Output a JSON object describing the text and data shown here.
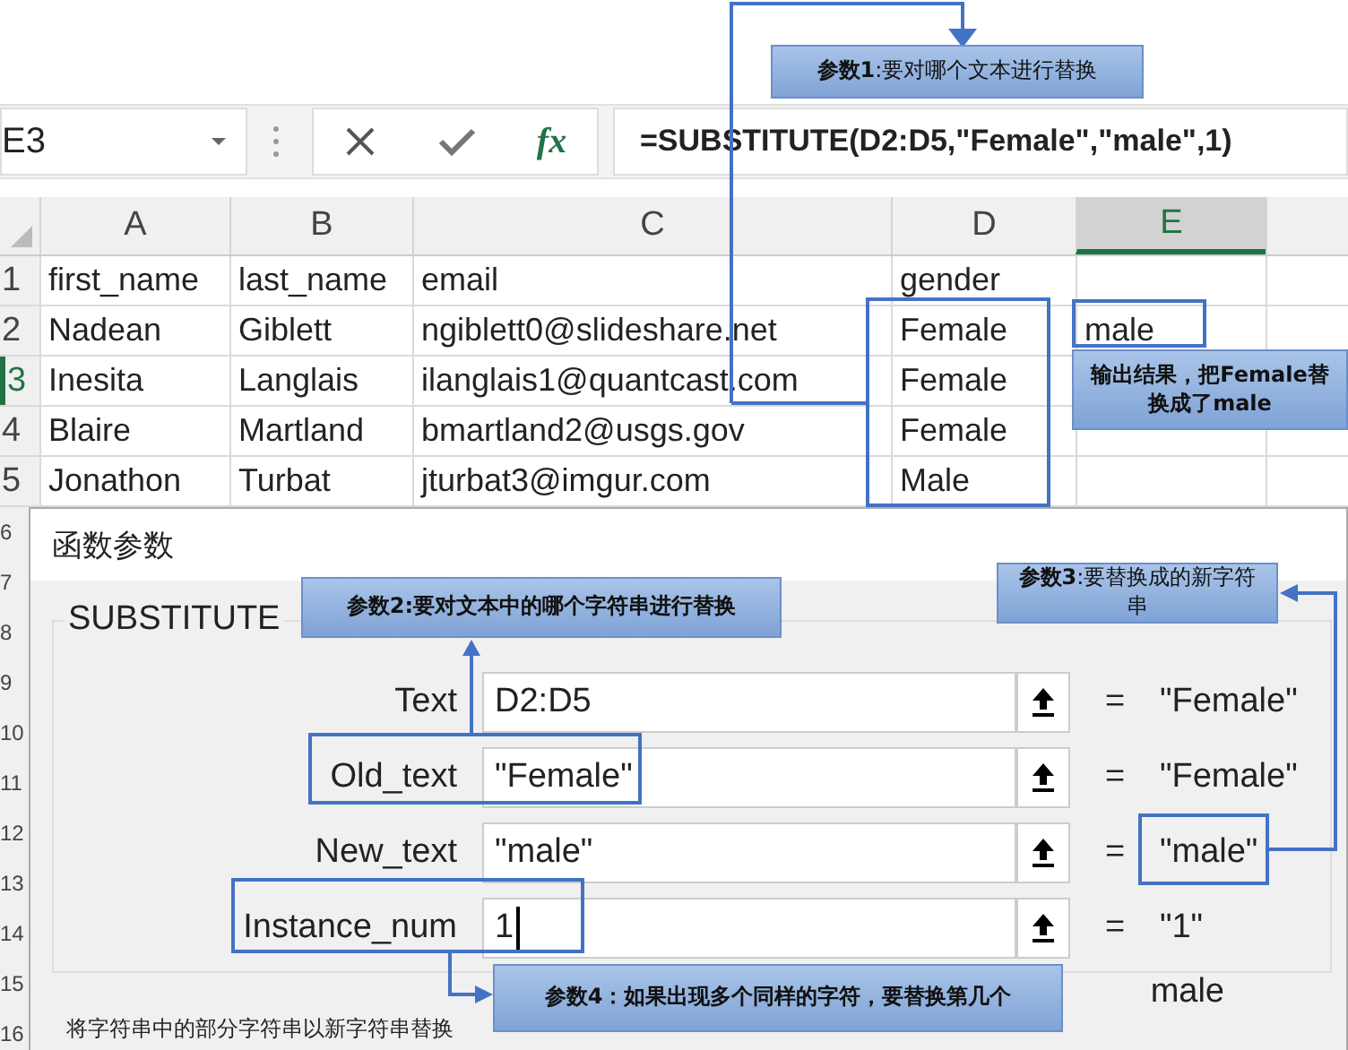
{
  "formula_bar": {
    "name_box": "E3",
    "fx": "fx",
    "formula": "=SUBSTITUTE(D2:D5,\"Female\",\"male\",1)"
  },
  "sheet": {
    "columns": [
      {
        "label": "A",
        "selected": false
      },
      {
        "label": "B",
        "selected": false
      },
      {
        "label": "C",
        "selected": false
      },
      {
        "label": "D",
        "selected": false
      },
      {
        "label": "E",
        "selected": true
      }
    ],
    "rows": [
      {
        "number": "1",
        "selected": false,
        "cells": [
          "first_name",
          "last_name",
          "email",
          "gender",
          ""
        ]
      },
      {
        "number": "2",
        "selected": false,
        "cells": [
          "Nadean",
          "Giblett",
          "ngiblett0@slideshare.net",
          "Female",
          "male"
        ]
      },
      {
        "number": "3",
        "selected": true,
        "cells": [
          "Inesita",
          "Langlais",
          "ilanglais1@quantcast.com",
          "Female",
          ""
        ]
      },
      {
        "number": "4",
        "selected": false,
        "cells": [
          "Blaire",
          "Martland",
          "bmartland2@usgs.gov",
          "Female",
          ""
        ]
      },
      {
        "number": "5",
        "selected": false,
        "cells": [
          "Jonathon",
          "Turbat",
          "jturbat3@imgur.com",
          "Male",
          ""
        ]
      }
    ],
    "hidden_row_numbers": [
      "6",
      "7",
      "8",
      "9",
      "10",
      "11",
      "12",
      "13",
      "14",
      "15",
      "16"
    ]
  },
  "dialog": {
    "title": "函数参数",
    "function": "SUBSTITUTE",
    "arguments": [
      {
        "label": "Text",
        "value": "D2:D5",
        "sign": "=",
        "result": "\"Female\""
      },
      {
        "label": "Old_text",
        "value": "\"Female\"",
        "sign": "=",
        "result": "\"Female\""
      },
      {
        "label": "New_text",
        "value": "\"male\"",
        "sign": "=",
        "result": "\"male\""
      },
      {
        "label": "Instance_num",
        "value": "1",
        "sign": "=",
        "result": "\"1\""
      }
    ],
    "formula_result": "male",
    "description": "将字符串中的部分字符串以新字符串替换"
  },
  "annotations": [
    {
      "text": "**参数1**:要对哪个文本进行替换",
      "bold": false
    },
    {
      "text": "输出结果，把Female替换成了male",
      "bold": true
    },
    {
      "text": "参数2:要对文本中的哪个字符串进行替换",
      "bold": true
    },
    {
      "text": "**参数3**:要替换成的新字符串",
      "bold": false
    },
    {
      "text": "参数4：如果出现多个同样的字符，要替换第几个",
      "bold": true
    }
  ]
}
